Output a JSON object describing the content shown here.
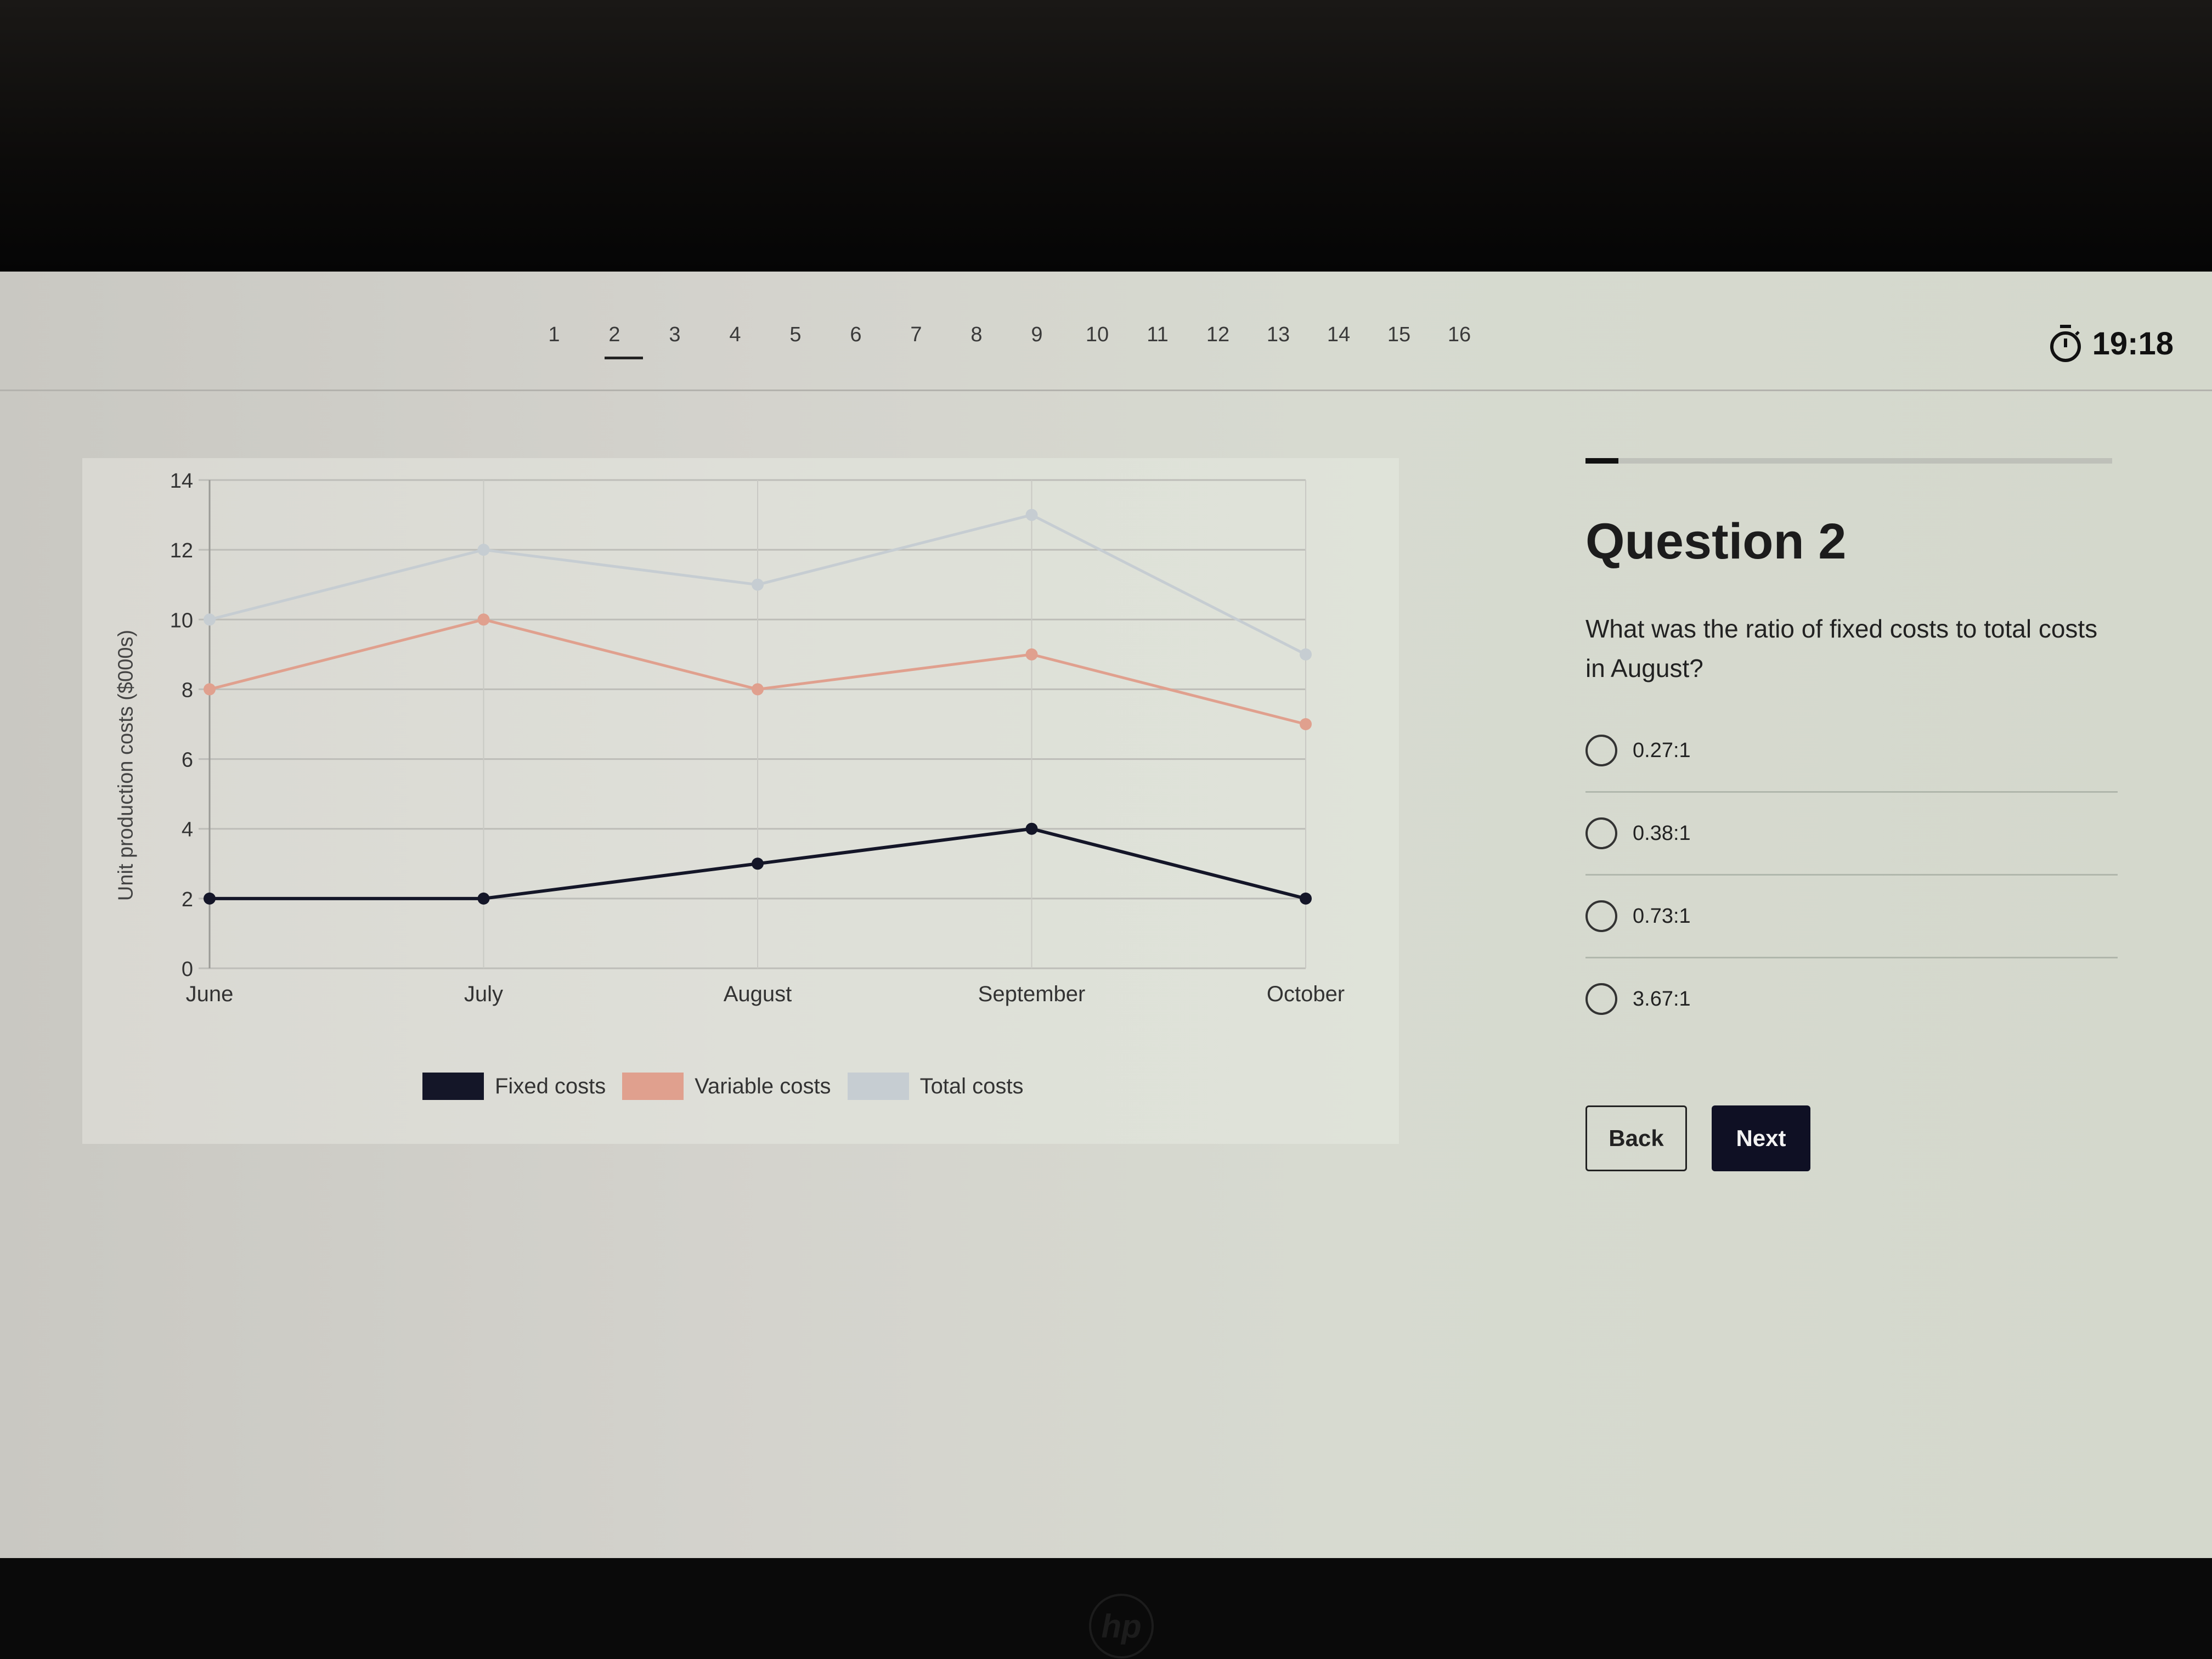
{
  "nav": {
    "questions": [
      "1",
      "2",
      "3",
      "4",
      "5",
      "6",
      "7",
      "8",
      "9",
      "10",
      "11",
      "12",
      "13",
      "14",
      "15",
      "16"
    ],
    "active_index": 1
  },
  "timer": {
    "icon": "stopwatch-icon",
    "value": "19:18"
  },
  "question": {
    "progress_fraction": 0.0625,
    "title": "Question 2",
    "text": "What was the ratio of fixed costs to total costs in August?",
    "options": [
      "0.27:1",
      "0.38:1",
      "0.73:1",
      "3.67:1"
    ],
    "back_label": "Back",
    "next_label": "Next"
  },
  "colors": {
    "fixed": "#141628",
    "variable": "#e0a08e",
    "total": "#c6cdd2",
    "next_button": "#0f1024"
  },
  "chart_data": {
    "type": "line",
    "title": "",
    "xlabel": "",
    "ylabel": "Unit production costs ($000s)",
    "categories": [
      "June",
      "July",
      "August",
      "September",
      "October"
    ],
    "ylim": [
      0,
      14
    ],
    "yticks": [
      0,
      2,
      4,
      6,
      8,
      10,
      12,
      14
    ],
    "grid": true,
    "legend_position": "bottom",
    "series": [
      {
        "name": "Fixed costs",
        "values": [
          2,
          2,
          3,
          4,
          2
        ]
      },
      {
        "name": "Variable costs",
        "values": [
          8,
          10,
          8,
          9,
          7
        ]
      },
      {
        "name": "Total costs",
        "values": [
          10,
          12,
          11,
          13,
          9
        ]
      }
    ]
  },
  "device": {
    "logo": "hp"
  }
}
